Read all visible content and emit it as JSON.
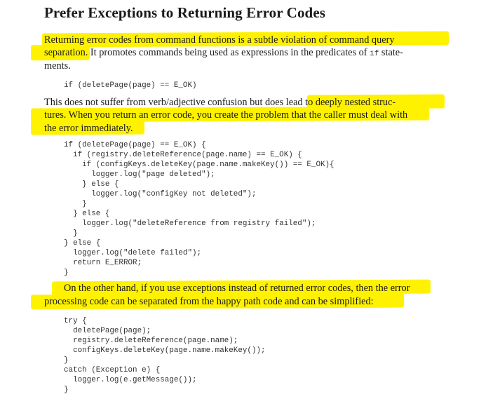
{
  "section": {
    "title": "Prefer Exceptions to Returning Error Codes"
  },
  "para1": {
    "line1": "Returning error codes from command functions is a subtle violation of command query",
    "line2a": "separation",
    "line2b": ". It promotes commands being used as expressions in the predicates of ",
    "line2_code": "if",
    "line2c": " state-",
    "line3": "ments."
  },
  "code1": "if (deletePage(page) == E_OK)",
  "para2": {
    "line1a": "This does not suffer from verb/adjective confusion but does ",
    "line1b": "lead to deeply nested struc-",
    "line2": "tures. When you return an error code, you create the problem that the caller must deal with",
    "line3": "the error immediately."
  },
  "code2": "if (deletePage(page) == E_OK) {\n  if (registry.deleteReference(page.name) == E_OK) {\n    if (configKeys.deleteKey(page.name.makeKey()) == E_OK){\n      logger.log(\"page deleted\");\n    } else {\n      logger.log(\"configKey not deleted\");\n    }\n  } else {\n    logger.log(\"deleteReference from registry failed\");\n  }\n} else {\n  logger.log(\"delete failed\");\n  return E_ERROR;\n}",
  "para3": {
    "line1": "On the other hand, if you use exceptions instead of returned error codes, then the error",
    "line2": "processing code can be separated from the happy path code and can be simplified:"
  },
  "code3": "try {\n  deletePage(page);\n  registry.deleteReference(page.name);\n  configKeys.deleteKey(page.name.makeKey());\n}\ncatch (Exception e) {\n  logger.log(e.getMessage());\n}",
  "colors": {
    "highlight": "#fff200",
    "text": "#1a1a1a",
    "code": "#333333"
  }
}
